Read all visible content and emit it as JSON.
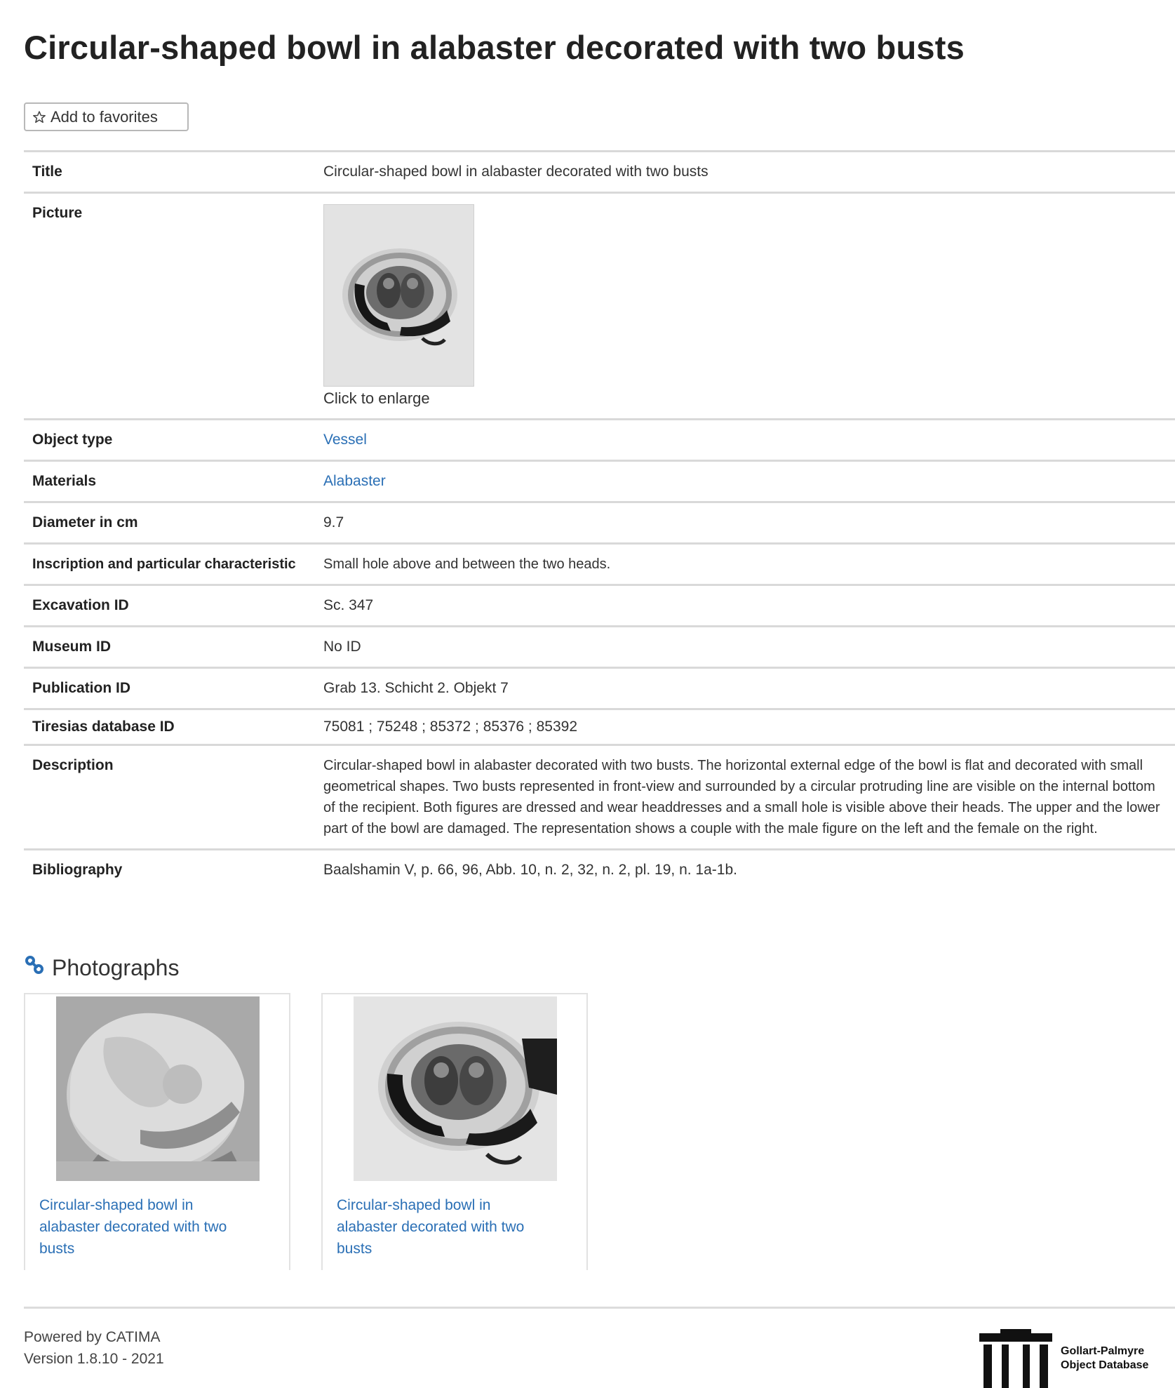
{
  "page": {
    "title": "Circular-shaped bowl in alabaster decorated with two busts"
  },
  "toolbar": {
    "favorites_label": "Add to favorites"
  },
  "attributes": {
    "title_label": "Title",
    "title_value": "Circular-shaped bowl in alabaster decorated with two busts",
    "picture_label": "Picture",
    "picture_enlarge": "Click to enlarge",
    "object_type_label": "Object type",
    "object_type_value": "Vessel",
    "materials_label": "Materials",
    "materials_value": "Alabaster",
    "diameter_label": "Diameter in cm",
    "diameter_value": "9.7",
    "inscription_label": "Inscription and particular characteristic",
    "inscription_value": "Small hole above and between the two heads.",
    "excavation_label": "Excavation ID",
    "excavation_value": "Sc. 347",
    "museum_label": "Museum ID",
    "museum_value": "No ID",
    "publication_label": "Publication ID",
    "publication_value": "Grab 13. Schicht 2. Objekt 7",
    "tiresias_label": "Tiresias database ID",
    "tiresias_value": "75081 ; 75248 ; 85372 ; 85376 ; 85392",
    "description_label": "Description",
    "description_value": "Circular-shaped bowl in alabaster decorated with two busts. The horizontal external edge of the bowl is flat and decorated with small geometrical shapes. Two busts represented in front-view and surrounded by a circular protruding line are visible on the internal bottom of the recipient. Both figures are dressed and wear headdresses and a small hole is visible above their heads. The upper and the lower part of the bowl are damaged. The representation shows a couple with the male figure on the left and the female on the right.",
    "bibliography_label": "Bibliography",
    "bibliography_value": "Baalshamin V, p. 66, 96, Abb. 10, n. 2, 32, n. 2, pl. 19, n. 1a-1b."
  },
  "photographs": {
    "heading": "Photographs",
    "items": [
      {
        "caption": "Circular-shaped bowl in alabaster decorated with two busts"
      },
      {
        "caption": "Circular-shaped bowl in alabaster decorated with two busts"
      }
    ]
  },
  "footer": {
    "powered_by": "Powered by CATIMA",
    "version": "Version 1.8.10 - 2021",
    "logo_line1": "Gollart-Palmyre",
    "logo_line2": "Object Database"
  },
  "icons": {
    "favorites": "star-outline-icon",
    "photographs": "link-icon",
    "logo": "building-columns-icon"
  },
  "colors": {
    "link": "#2a6fb5",
    "row_border": "#d9d9d9",
    "text": "#222222"
  }
}
